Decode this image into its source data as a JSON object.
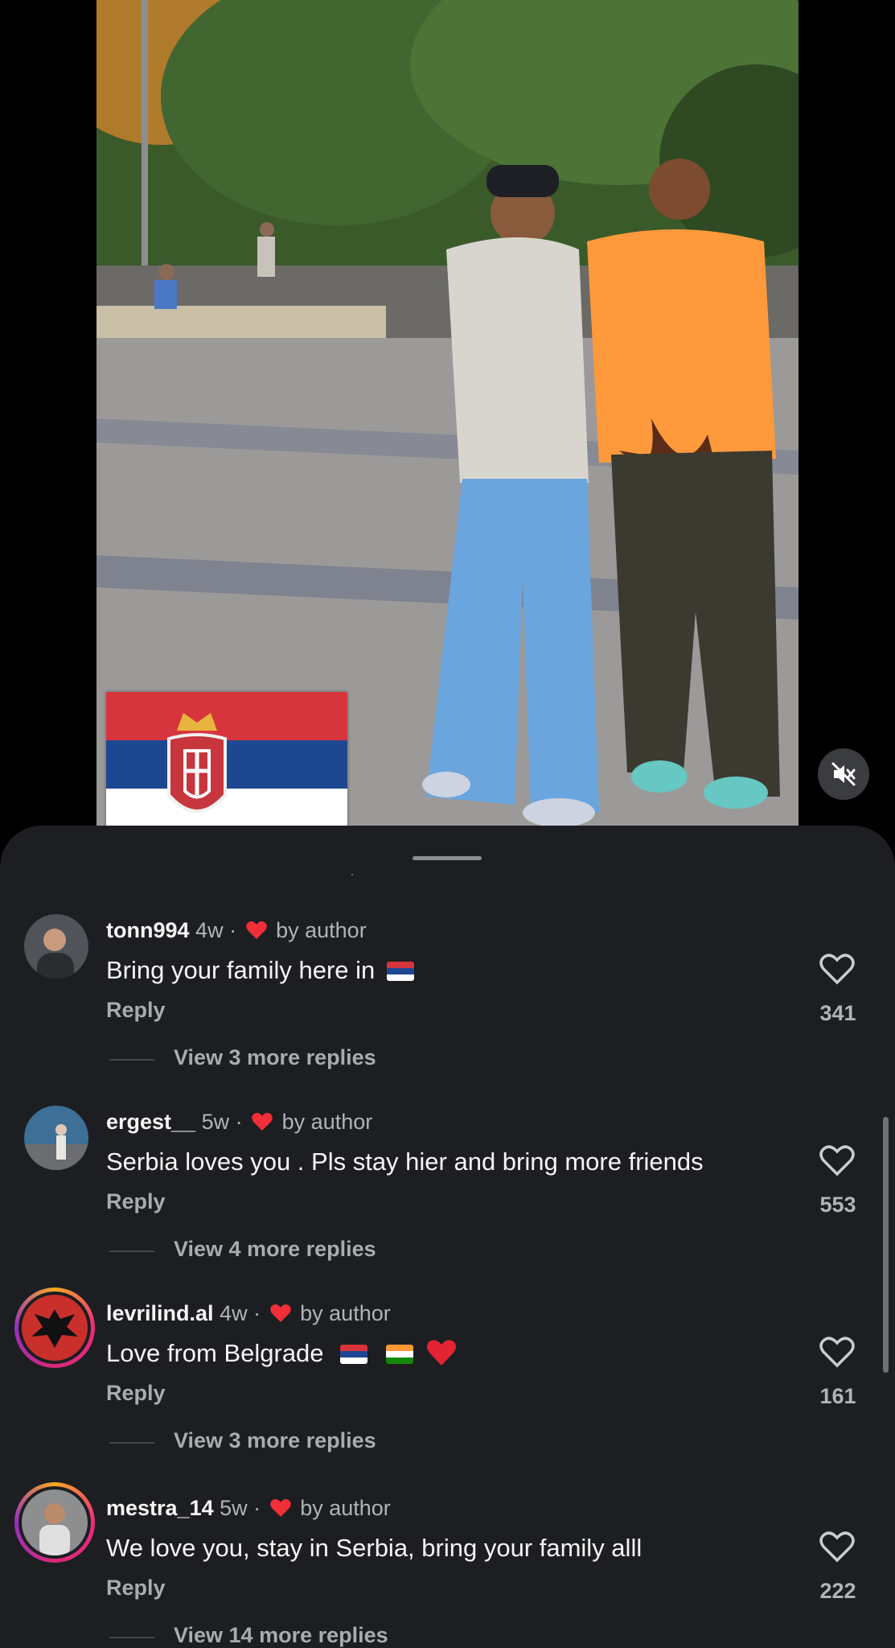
{
  "video": {
    "sticker": "serbian-flag",
    "mute_icon": "speaker-muted-icon",
    "colors": {
      "flag_red": "#d7353d",
      "flag_blue": "#1e4791",
      "flag_white": "#ffffff"
    }
  },
  "comments_sheet": {
    "background": "#1c1e21",
    "comments": [
      {
        "username": "tonn994",
        "time": "4w",
        "separator": "·",
        "liked_by_author_label": "by author",
        "text": "Bring your family here in",
        "emojis": [
          "serbia-flag"
        ],
        "reply_label": "Reply",
        "like_count": "341",
        "view_replies_label": "View 3 more replies"
      },
      {
        "username": "ergest__",
        "time": "5w",
        "separator": "·",
        "liked_by_author_label": "by author",
        "text": "Serbia loves you . Pls stay hier and bring more friends",
        "emojis": [],
        "reply_label": "Reply",
        "like_count": "553",
        "view_replies_label": "View 4 more replies"
      },
      {
        "username": "levrilind.al",
        "time": "4w",
        "separator": "·",
        "liked_by_author_label": "by author",
        "text": "Love from Belgrade",
        "emojis": [
          "serbia-flag",
          "india-flag",
          "red-heart"
        ],
        "reply_label": "Reply",
        "like_count": "161",
        "view_replies_label": "View 3 more replies"
      },
      {
        "username": "mestra_14",
        "time": "5w",
        "separator": "·",
        "liked_by_author_label": "by author",
        "text": "We love you, stay in Serbia, bring your family alll",
        "emojis": [],
        "reply_label": "Reply",
        "like_count": "222",
        "view_replies_label": "View 14 more replies"
      }
    ]
  }
}
